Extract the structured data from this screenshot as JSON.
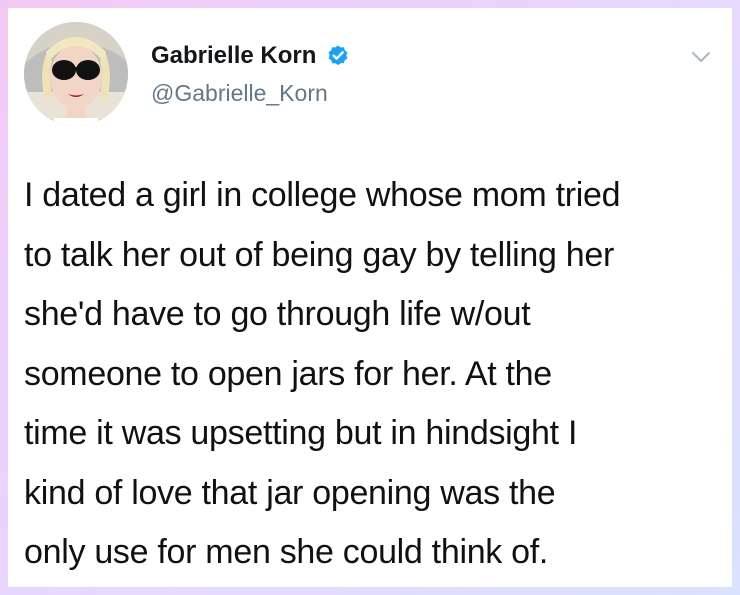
{
  "author": {
    "display_name": "Gabrielle Korn",
    "handle": "@Gabrielle_Korn",
    "verified": true,
    "avatar_icon": "profile-photo-woman-sunglasses"
  },
  "tweet": {
    "lines": [
      "I dated a girl in college whose mom tried",
      "to talk her out of being gay by telling her",
      "she'd have to go through life w/out",
      "someone to open jars for her. At the",
      "time it was upsetting but in hindsight I",
      "kind of love that jar opening was the",
      "only use for men she could think of."
    ]
  },
  "colors": {
    "verified_badge": "#1da1f2",
    "handle": "#657786",
    "chevron": "#aab8c2",
    "frame_gradient_start": "#f2c9f5",
    "frame_gradient_end": "#d9e2ff"
  },
  "icons": {
    "verified": "verified-badge-icon",
    "menu": "chevron-down-icon"
  }
}
